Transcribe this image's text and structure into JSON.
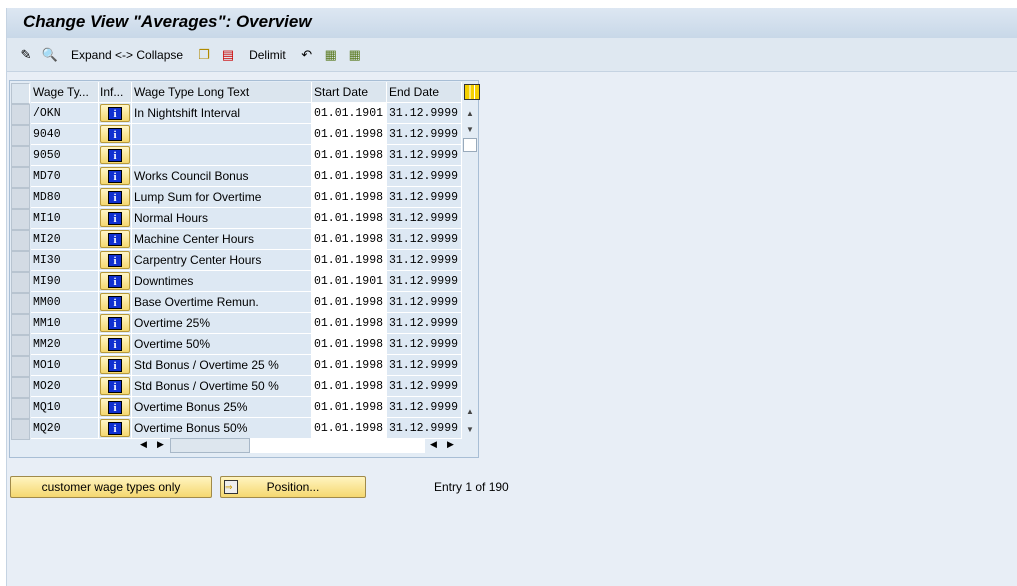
{
  "title": "Change View \"Averages\": Overview",
  "toolbar": {
    "expand_collapse": "Expand <-> Collapse",
    "delimit": "Delimit"
  },
  "table": {
    "headers": [
      "Wage Ty...",
      "Inf...",
      "Wage Type Long Text",
      "Start Date",
      "End Date"
    ],
    "rows": [
      [
        "/OKN",
        "In Nightshift Interval",
        "01.01.1901",
        "31.12.9999"
      ],
      [
        "9040",
        "",
        "01.01.1998",
        "31.12.9999"
      ],
      [
        "9050",
        "",
        "01.01.1998",
        "31.12.9999"
      ],
      [
        "MD70",
        "Works Council Bonus",
        "01.01.1998",
        "31.12.9999"
      ],
      [
        "MD80",
        "Lump Sum for Overtime",
        "01.01.1998",
        "31.12.9999"
      ],
      [
        "MI10",
        "Normal Hours",
        "01.01.1998",
        "31.12.9999"
      ],
      [
        "MI20",
        "Machine Center Hours",
        "01.01.1998",
        "31.12.9999"
      ],
      [
        "MI30",
        "Carpentry Center Hours",
        "01.01.1998",
        "31.12.9999"
      ],
      [
        "MI90",
        "Downtimes",
        "01.01.1901",
        "31.12.9999"
      ],
      [
        "MM00",
        "Base Overtime Remun.",
        "01.01.1998",
        "31.12.9999"
      ],
      [
        "MM10",
        "Overtime 25%",
        "01.01.1998",
        "31.12.9999"
      ],
      [
        "MM20",
        "Overtime 50%",
        "01.01.1998",
        "31.12.9999"
      ],
      [
        "MO10",
        "Std Bonus / Overtime 25 %",
        "01.01.1998",
        "31.12.9999"
      ],
      [
        "MO20",
        "Std Bonus / Overtime 50 %",
        "01.01.1998",
        "31.12.9999"
      ],
      [
        "MQ10",
        "Overtime Bonus 25%",
        "01.01.1998",
        "31.12.9999"
      ],
      [
        "MQ20",
        "Overtime Bonus 50%",
        "01.01.1998",
        "31.12.9999"
      ]
    ]
  },
  "buttons": {
    "customer": "customer wage types only",
    "position": "Position..."
  },
  "entry": "Entry 1 of 190"
}
